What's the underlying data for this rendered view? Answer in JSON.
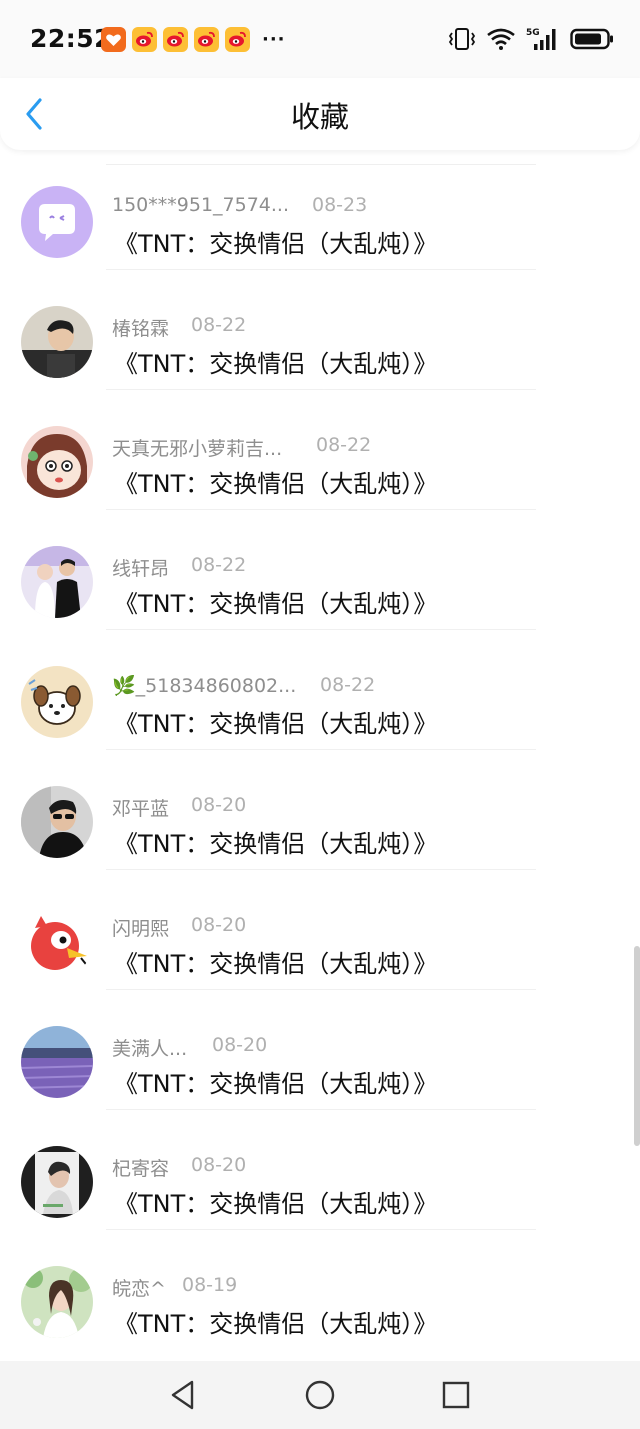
{
  "status_bar": {
    "time": "22:52",
    "more": "···",
    "network": "5G"
  },
  "header": {
    "title": "收藏"
  },
  "items": [
    {
      "user": "150***951_7574...",
      "date": "08-23",
      "title": "《TNT：交换情侣（大乱炖）》",
      "avatar": "purple-chat-avatar"
    },
    {
      "user": "椿铭霖",
      "date": "08-22",
      "title": "《TNT：交换情侣（大乱炖）》",
      "avatar": "boy-photo-avatar"
    },
    {
      "user": "天真无邪小萝莉吉...",
      "date": "08-22",
      "title": "《TNT：交换情侣（大乱炖）》",
      "avatar": "cartoon-girl-avatar"
    },
    {
      "user": "线轩昂",
      "date": "08-22",
      "title": "《TNT：交换情侣（大乱炖）》",
      "avatar": "couple-photo-avatar"
    },
    {
      "user": "🌿_51834860802...",
      "date": "08-22",
      "title": "《TNT：交换情侣（大乱炖）》",
      "avatar": "cartoon-dog-avatar"
    },
    {
      "user": "邓平蓝",
      "date": "08-20",
      "title": "《TNT：交换情侣（大乱炖）》",
      "avatar": "sunglasses-avatar"
    },
    {
      "user": "闪明熙",
      "date": "08-20",
      "title": "《TNT：交换情侣（大乱炖）》",
      "avatar": "red-bird-avatar"
    },
    {
      "user": "美满人...",
      "date": "08-20",
      "title": "《TNT：交换情侣（大乱炖）》",
      "avatar": "lavender-field-avatar"
    },
    {
      "user": "杞寄容",
      "date": "08-20",
      "title": "《TNT：交换情侣（大乱炖）》",
      "avatar": "portrait-avatar"
    },
    {
      "user": "皖恋^",
      "date": "08-19",
      "title": "《TNT：交换情侣（大乱炖）》",
      "avatar": "garden-girl-avatar"
    }
  ],
  "colors": {
    "accent": "#2a9cf0",
    "username": "#8e8e8e",
    "date": "#b0b0b0",
    "title": "#111111"
  }
}
